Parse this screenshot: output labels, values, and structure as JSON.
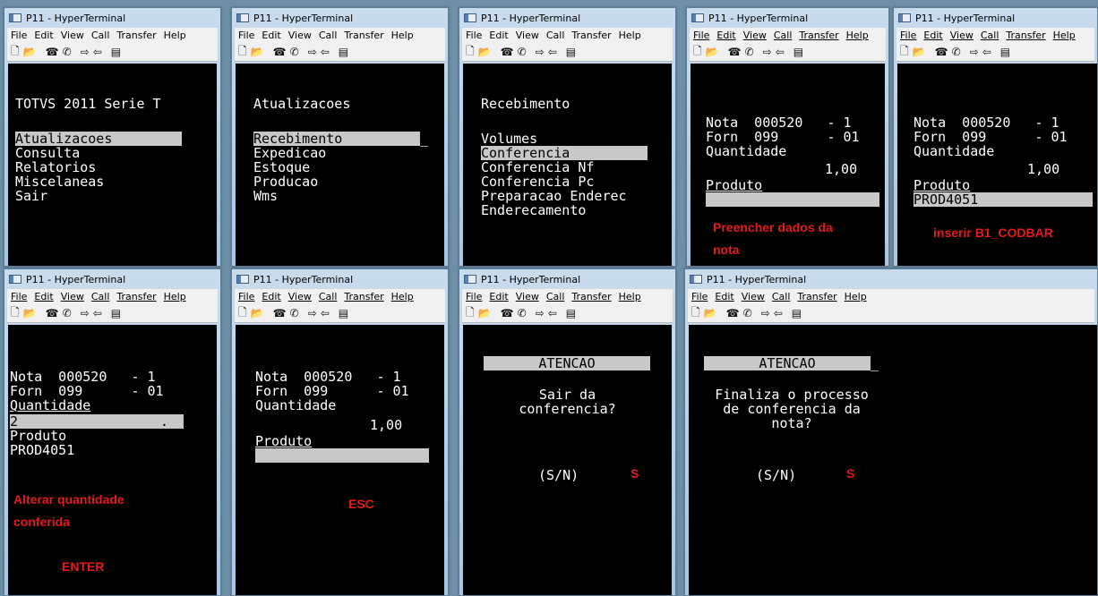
{
  "window_title": "P11 - HyperTerminal",
  "menu": [
    "File",
    "Edit",
    "View",
    "Call",
    "Transfer",
    "Help"
  ],
  "toolbar_icons": [
    "new-icon",
    "open-icon",
    "disconnect-icon",
    "dial-icon",
    "send-icon",
    "receive-icon",
    "properties-icon"
  ],
  "colors": {
    "annotation": "#e41b1b",
    "highlight": "#c8c8c8",
    "terminal_bg": "#000000"
  },
  "panels": {
    "p1": {
      "title": "TOTVS 2011 Serie T",
      "items": [
        "Atualizacoes",
        "Consulta",
        "Relatorios",
        "Miscelaneas",
        "Sair"
      ]
    },
    "p2": {
      "title": "Atualizacoes",
      "items": [
        "Recebimento",
        "Expedicao",
        "Estoque",
        "Producao",
        "Wms"
      ]
    },
    "p3": {
      "title": "Recebimento",
      "items": [
        "Volumes",
        "Conferencia",
        "Conferencia Nf",
        "Conferencia Pc",
        "Preparacao Enderec",
        "Enderecamento"
      ]
    },
    "p4": {
      "nota": "Nota  000520   - 1",
      "forn": "Forn  099      - 01",
      "qtd_label": "Quantidade",
      "qtd_value": "1,00",
      "prod_label": "Produto",
      "note": "Preencher dados da\nnota"
    },
    "p5": {
      "nota": "Nota  000520   - 1",
      "forn": "Forn  099      - 01",
      "qtd_label": "Quantidade",
      "qtd_value": "1,00",
      "prod_label": "Produto",
      "prod_value": "PROD4051_",
      "note": "inserir B1_CODBAR"
    },
    "p6": {
      "nota": "Nota  000520   - 1",
      "forn": "Forn  099      - 01",
      "qtd_label": "Quantidade",
      "qtd_input": "2_",
      "qtd_dot": ".",
      "prod_label": "Produto",
      "prod_value": "PROD4051",
      "note": "Alterar quantidade\nconferida",
      "note2": "ENTER"
    },
    "p7": {
      "nota": "Nota  000520   - 1",
      "forn": "Forn  099      - 01",
      "qtd_label": "Quantidade",
      "qtd_value": "1,00",
      "prod_label": "Produto",
      "prod_input": "_",
      "note": "ESC"
    },
    "p8": {
      "header": "ATENCAO",
      "msg1": "Sair da",
      "msg2": "conferencia?",
      "opt": "(S/N)",
      "note": "S"
    },
    "p9": {
      "header": "ATENCAO",
      "msg1": "Finaliza o processo",
      "msg2": "de conferencia da",
      "msg3": "nota?",
      "opt": "(S/N)",
      "note": "S"
    }
  }
}
